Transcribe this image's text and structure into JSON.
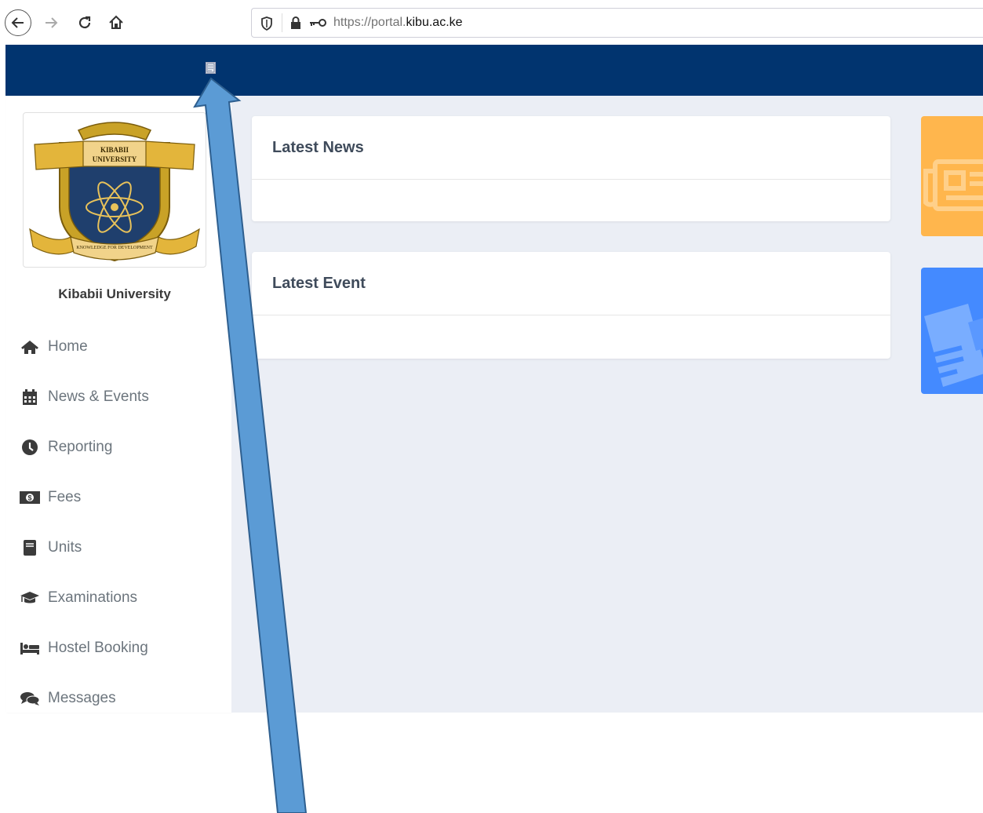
{
  "browser": {
    "url_prefix": "https://portal.",
    "url_host": "kibu.ac.ke"
  },
  "sidebar": {
    "university_name": "Kibabii University",
    "logo_text_top": "KIBABII",
    "logo_text_mid": "UNIVERSITY",
    "logo_motto": "KNOWLEDGE FOR DEVELOPMENT",
    "items": [
      {
        "label": "Home",
        "icon": "home-icon"
      },
      {
        "label": "News & Events",
        "icon": "calendar-icon"
      },
      {
        "label": "Reporting",
        "icon": "clock-icon"
      },
      {
        "label": "Fees",
        "icon": "money-icon"
      },
      {
        "label": "Units",
        "icon": "book-icon"
      },
      {
        "label": "Examinations",
        "icon": "graduation-cap-icon"
      },
      {
        "label": "Hostel Booking",
        "icon": "bed-icon"
      },
      {
        "label": "Messages",
        "icon": "comments-icon"
      }
    ]
  },
  "main": {
    "cards": [
      {
        "title": "Latest News"
      },
      {
        "title": "Latest Event"
      }
    ]
  },
  "colors": {
    "header": "#01346f",
    "main_bg": "#ebeef5",
    "tile_orange": "#ffb64d",
    "tile_blue": "#448aff",
    "arrow": "#5b9bd5"
  }
}
